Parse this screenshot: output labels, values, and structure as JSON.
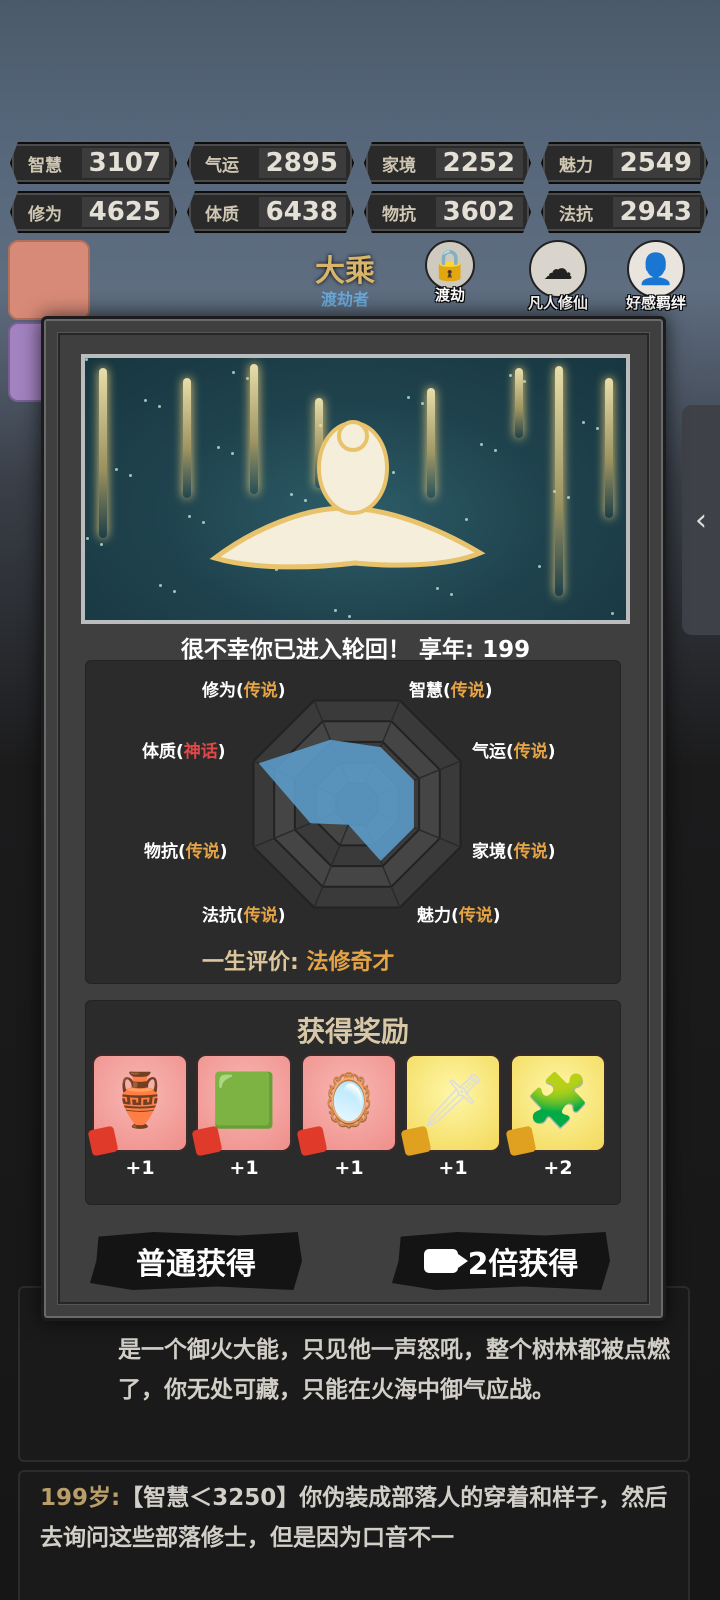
{
  "stats": [
    {
      "label": "智慧",
      "value": "3107"
    },
    {
      "label": "气运",
      "value": "2895"
    },
    {
      "label": "家境",
      "value": "2252"
    },
    {
      "label": "魅力",
      "value": "2549"
    },
    {
      "label": "修为",
      "value": "4625"
    },
    {
      "label": "体质",
      "value": "6438"
    },
    {
      "label": "物抗",
      "value": "3602"
    },
    {
      "label": "法抗",
      "value": "2943"
    }
  ],
  "header": {
    "realm": "大乘",
    "realm_sub": "渡劫者",
    "dujie_label": "渡劫",
    "mortal_label": "凡人修仙",
    "bond_label": "好感羁绊"
  },
  "modal": {
    "death_text": "很不幸你已进入轮回！ 享年: 199",
    "radar_labels": [
      {
        "name": "修为",
        "grade": "传说",
        "tier": "legend"
      },
      {
        "name": "智慧",
        "grade": "传说",
        "tier": "legend"
      },
      {
        "name": "体质",
        "grade": "神话",
        "tier": "myth"
      },
      {
        "name": "气运",
        "grade": "传说",
        "tier": "legend"
      },
      {
        "name": "物抗",
        "grade": "传说",
        "tier": "legend"
      },
      {
        "name": "家境",
        "grade": "传说",
        "tier": "legend"
      },
      {
        "name": "法抗",
        "grade": "传说",
        "tier": "legend"
      },
      {
        "name": "魅力",
        "grade": "传说",
        "tier": "legend"
      }
    ],
    "radar_values": {
      "修为": 0.62,
      "智慧": 0.55,
      "气运": 0.55,
      "家境": 0.55,
      "魅力": 0.55,
      "法抗": 0.2,
      "物抗": 0.45,
      "体质": 0.95
    },
    "eval_label": "一生评价:",
    "eval_value": "法修奇才",
    "reward_title": "获得奖励",
    "rewards": [
      {
        "icon": "incense-burner-icon",
        "glyph": "🏺",
        "bg": "pink",
        "count": "+1"
      },
      {
        "icon": "jade-seal-icon",
        "glyph": "🟩",
        "bg": "pink",
        "count": "+1"
      },
      {
        "icon": "mirror-icon",
        "glyph": "🪞",
        "bg": "pink",
        "count": "+1"
      },
      {
        "icon": "sword-icon",
        "glyph": "🗡",
        "bg": "gold",
        "count": "+1"
      },
      {
        "icon": "puzzle-piece-icon",
        "glyph": "🧩",
        "bg": "gold",
        "count": "+2"
      }
    ],
    "btn_normal": "普通获得",
    "btn_double": "2倍获得"
  },
  "log": {
    "entry1": "是一个御火大能，只见他一声怒吼，整个树林都被点燃了，你无处可藏，只能在火海中御气应战。",
    "entry2_age": "199岁:",
    "entry2_text": "【智慧＜3250】你伪装成部落人的穿着和样子，然后去询问这些部落修士，但是因为口音不一"
  },
  "colors": {
    "legend": "#e4a445",
    "myth": "#e04848",
    "radar_fill": "#5b9bc9"
  }
}
